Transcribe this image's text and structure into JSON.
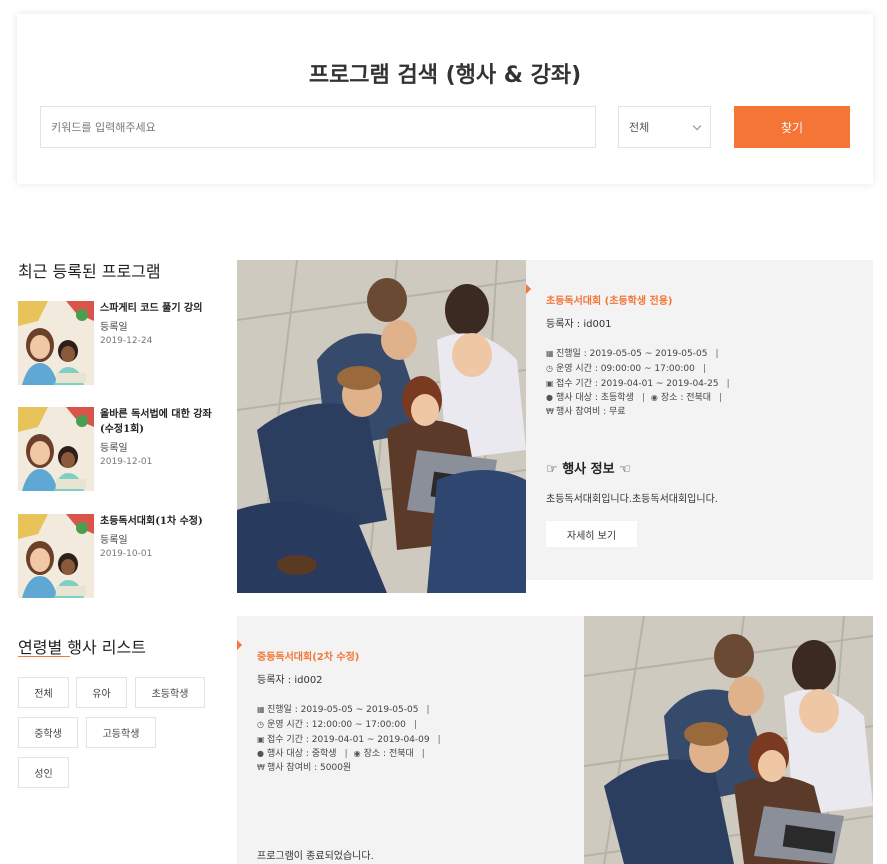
{
  "search": {
    "title": "프로그램 검색 (행사 & 강좌)",
    "placeholder": "키워드를 입력해주세요",
    "value": "",
    "select_value": "전체",
    "button_label": "찾기",
    "accent": "#f57536"
  },
  "sidebar": {
    "recent_title": "최근 등록된 프로그램",
    "recent": [
      {
        "name": "스파게티 코드 풀기 강의",
        "reg_label": "등록일",
        "date": "2019-12-24"
      },
      {
        "name": "올바른 독서법에 대한 강좌 (수정1회)",
        "reg_label": "등록일",
        "date": "2019-12-01"
      },
      {
        "name": "초등독서대회(1차 수정)",
        "reg_label": "등록일",
        "date": "2019-10-01"
      }
    ],
    "age_title": "연령별 행사 리스트",
    "ages": [
      "전체",
      "유아",
      "초등학생",
      "중학생",
      "고등학생",
      "성인"
    ]
  },
  "programs": [
    {
      "name": "초등독서대회 (초등학생 전용)",
      "registrant": "등록자 : id001",
      "period": "진행일 : 2019-05-05 ~ 2019-05-05",
      "hours": "운영 시간 : 09:00:00 ~ 17:00:00",
      "reception": "접수 기간 : 2019-04-01 ~ 2019-04-25",
      "target": "행사 대상 : 초등학생",
      "place": "장소 : 전북대",
      "fee": "행사 참여비 : 무료",
      "info_title": "행사 정보",
      "description": "초등독서대회입니다.초등독서대회입니다.",
      "button_label": "자세히 보기"
    },
    {
      "name": "중등독서대회(2차 수정)",
      "registrant": "등록자 : id002",
      "period": "진행일 : 2019-05-05 ~ 2019-05-05",
      "hours": "운영 시간 : 12:00:00 ~ 17:00:00",
      "reception": "접수 기간 : 2019-04-01 ~ 2019-04-09",
      "target": "행사 대상 : 중학생",
      "place": "장소 : 전북대",
      "fee": "행사 참여비 : 5000원",
      "status": "프로그램이 종료되었습니다."
    }
  ]
}
